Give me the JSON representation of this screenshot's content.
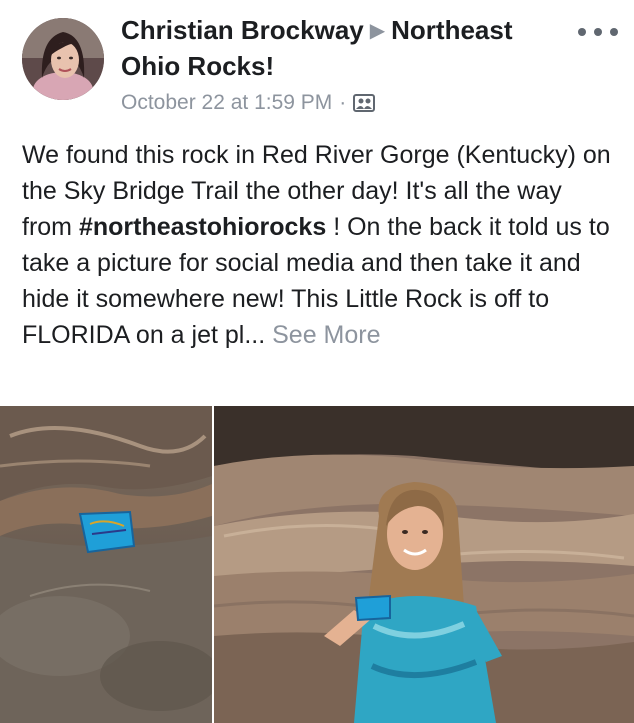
{
  "post": {
    "author": "Christian Brockway",
    "group": "Northeast Ohio Rocks!",
    "timestamp": "October 22 at 1:59 PM",
    "privacy_icon": "group-album-icon",
    "text_intro": "We found this rock in Red River Gorge (Kentucky) on the Sky Bridge Trail the other day! It's all the way from",
    "hashtag": "#northeastohiorocks",
    "text_rest": "! On the back it told us to take a picture for social media and then take it and hide it somewhere new! This Little Rock is off to FLORIDA on a jet pl...",
    "see_more": "See More"
  },
  "colors": {
    "secondary_text": "#8d949e",
    "primary_text": "#1c1e21",
    "rock_blue": "#1f9fd8"
  },
  "icons": {
    "more": "more-options-icon",
    "arrow": "right-arrow-icon"
  }
}
